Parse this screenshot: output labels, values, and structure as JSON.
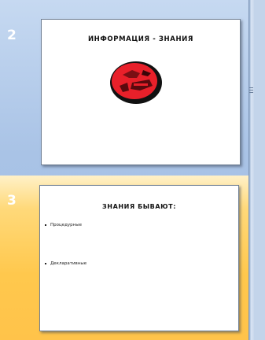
{
  "slides_pane": {
    "slides": [
      {
        "number": "2",
        "title": "ИНФОРМАЦИЯ - ЗНАНИЯ",
        "picture_icon": "red-blob-image-icon"
      },
      {
        "number": "3",
        "title": "ЗНАНИЯ БЫВАЮТ:",
        "bullets": [
          "Процедурные",
          "Декларативные"
        ],
        "selected": true
      }
    ]
  },
  "colors": {
    "pane_background": "#a9c3e6",
    "selected_highlight": "#ffc84d",
    "picture_fill": "#e8202a"
  }
}
